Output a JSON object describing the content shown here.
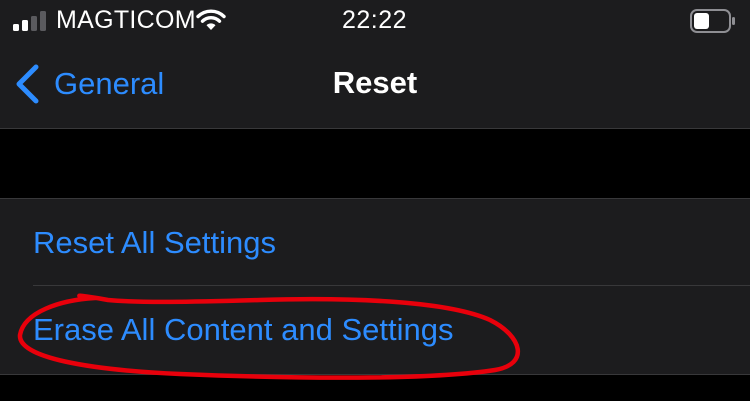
{
  "status_bar": {
    "carrier": "MAGTICOM",
    "time": "22:22",
    "icons": [
      "signal-bars-icon",
      "wifi-icon",
      "battery-icon"
    ]
  },
  "nav_bar": {
    "back_label": "General",
    "title": "Reset"
  },
  "settings_group": {
    "items": [
      {
        "label": "Reset All Settings"
      },
      {
        "label": "Erase All Content and Settings"
      }
    ]
  },
  "colors": {
    "background": "#000000",
    "cell_background": "#1c1c1e",
    "separator": "#38383a",
    "accent_blue": "#2d8cff",
    "annotation_red": "#e8000b",
    "text_primary": "#ffffff"
  }
}
